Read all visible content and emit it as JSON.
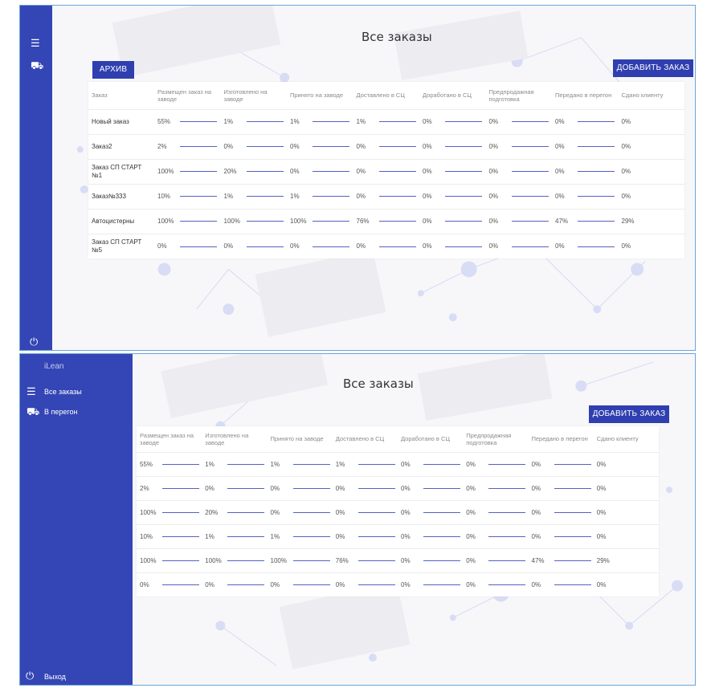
{
  "app": {
    "brand": "iLean"
  },
  "title": "Все заказы",
  "sidebar": {
    "items": [
      {
        "label": "Все заказы",
        "icon": "list-icon"
      },
      {
        "label": "В перегон",
        "icon": "truck-icon"
      }
    ],
    "logout": {
      "label": "Выход",
      "icon": "power-icon"
    }
  },
  "buttons": {
    "archive": "АРХИВ",
    "add_order": "ДОБАВИТЬ ЗАКАЗ"
  },
  "table": {
    "order_header": "Заказ",
    "stage_headers": [
      "Размещен заказ на заводе",
      "Изготовлено на заводе",
      "Принято на заводе",
      "Доставлено в СЦ",
      "Доработано в СЦ",
      "Предпродажная подготовка",
      "Передано в перегон",
      "Сдано клиенту"
    ],
    "rows": [
      {
        "name": "Новый заказ",
        "values": [
          "55%",
          "1%",
          "1%",
          "1%",
          "0%",
          "0%",
          "0%",
          "0%"
        ]
      },
      {
        "name": "Заказ2",
        "values": [
          "2%",
          "0%",
          "0%",
          "0%",
          "0%",
          "0%",
          "0%",
          "0%"
        ]
      },
      {
        "name": "Заказ СП СТАРТ №1",
        "values": [
          "100%",
          "20%",
          "0%",
          "0%",
          "0%",
          "0%",
          "0%",
          "0%"
        ]
      },
      {
        "name": "Заказ№333",
        "values": [
          "10%",
          "1%",
          "1%",
          "0%",
          "0%",
          "0%",
          "0%",
          "0%"
        ]
      },
      {
        "name": "Автоцистерны",
        "values": [
          "100%",
          "100%",
          "100%",
          "76%",
          "0%",
          "0%",
          "47%",
          "29%"
        ]
      },
      {
        "name": "Заказ СП СТАРТ №5",
        "values": [
          "0%",
          "0%",
          "0%",
          "0%",
          "0%",
          "0%",
          "0%",
          "0%"
        ]
      }
    ]
  },
  "colors": {
    "sidebar": "#3446b5",
    "button": "#2f3fb0",
    "bar": "#5461c6"
  }
}
